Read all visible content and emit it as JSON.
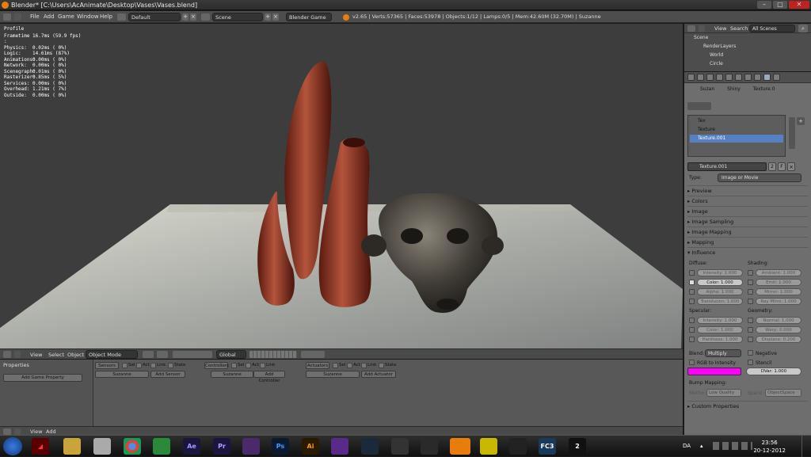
{
  "title_bar": {
    "title": "Blender* [C:\\Users\\AcAnimate\\Desktop\\Vases\\Vases.blend]"
  },
  "info_header": {
    "menus": [
      "File",
      "Add",
      "Game",
      "Window",
      "Help"
    ],
    "screen_layout": "Default",
    "scene": "Scene",
    "engine": "Blender Game",
    "stats": "v2.65 | Verts:57365 | Faces:53978 | Objects:1/12 | Lamps:0/5 | Mem:42.60M (32.70M) | Suzanne"
  },
  "profile": {
    "title": "Profile",
    "rows": [
      {
        "label": "Frametime :",
        "value": "16.7ms (59.9 fps)"
      },
      {
        "label": "Physics:",
        "value": "0.02ms ( 0%)"
      },
      {
        "label": "Logic:",
        "value": "14.61ms (87%)"
      },
      {
        "label": "Animations:",
        "value": "0.00ms ( 0%)"
      },
      {
        "label": "Network:",
        "value": "0.00ms ( 0%)"
      },
      {
        "label": "Scenegraph:",
        "value": "0.01ms ( 0%)"
      },
      {
        "label": "Rasterizer:",
        "value": "0.85ms ( 5%)"
      },
      {
        "label": "Services:",
        "value": "0.00ms ( 0%)"
      },
      {
        "label": "Overhead:",
        "value": "1.21ms ( 7%)"
      },
      {
        "label": "Outside:",
        "value": "0.00ms ( 0%)"
      }
    ]
  },
  "view_header": {
    "view": "View",
    "select": "Select",
    "object": "Object",
    "mode": "Object Mode",
    "orientation": "Global"
  },
  "logic": {
    "properties_label": "Properties",
    "add_game_property": "Add Game Property",
    "sensors": "Sensors",
    "controllers": "Controllers",
    "actuators": "Actuators",
    "sel": "Sel",
    "act": "Act",
    "link": "Link",
    "state": "State",
    "obj": "Suzanne",
    "add_sensor": "Add Sensor",
    "add_controller": "Add Controller",
    "add_actuator": "Add Actuator"
  },
  "logic_footer": {
    "view": "View",
    "add": "Add"
  },
  "outliner": {
    "view": "View",
    "search": "Search",
    "filter": "All Scenes",
    "items": [
      "Scene",
      "RenderLayers",
      "World",
      "Circle"
    ]
  },
  "properties": {
    "breadcrumb": [
      "Suzan",
      "Shiny",
      "Texture.0"
    ],
    "textures": [
      "Tex",
      "Texture",
      "Texture.001"
    ],
    "texture_name": "Texture.001",
    "users": "2",
    "fake": "F",
    "type_label": "Type:",
    "type_value": "Image or Movie",
    "panels": [
      "Preview",
      "Colors",
      "Image",
      "Image Sampling",
      "Image Mapping",
      "Mapping"
    ],
    "influence": "Influence",
    "diffuse": "Diffuse:",
    "shading": "Shading:",
    "specular": "Specular:",
    "geometry": "Geometry:",
    "diffuse_items": [
      "Intensity: 1.000",
      "Color: 1.000",
      "Alpha: 1.000",
      "Translucen: 1.000"
    ],
    "shading_items": [
      "Ambient: 1.000",
      "Emit: 1.000",
      "Mirror: 1.000",
      "Ray Mirro: 1.000"
    ],
    "specular_items": [
      "Intensity: 1.000",
      "Color: 1.000",
      "Hardness: 1.000"
    ],
    "geometry_items": [
      "Normal: 1.000",
      "Warp: 0.000",
      "Displace: 0.200"
    ],
    "blend_label": "Blend:",
    "blend_value": "Multiply",
    "negative": "Negative",
    "rgb_to_intensity": "RGB to Intensity",
    "stencil": "Stencil",
    "dvar": "DVar: 1.000",
    "bump_mapping": "Bump Mapping:",
    "method_label": "Metho:",
    "method_value": "Low Quality",
    "space_label": "Space:",
    "space_value": "ObjectSpace",
    "custom_properties": "Custom Properties",
    "color_swatch": "#ff00ff"
  },
  "taskbar": {
    "icons": [
      "Ae",
      "Pr",
      "Ps",
      "Ai",
      "FC3",
      "2"
    ],
    "lang": "DA",
    "time": "23:56",
    "date": "20-12-2012"
  }
}
